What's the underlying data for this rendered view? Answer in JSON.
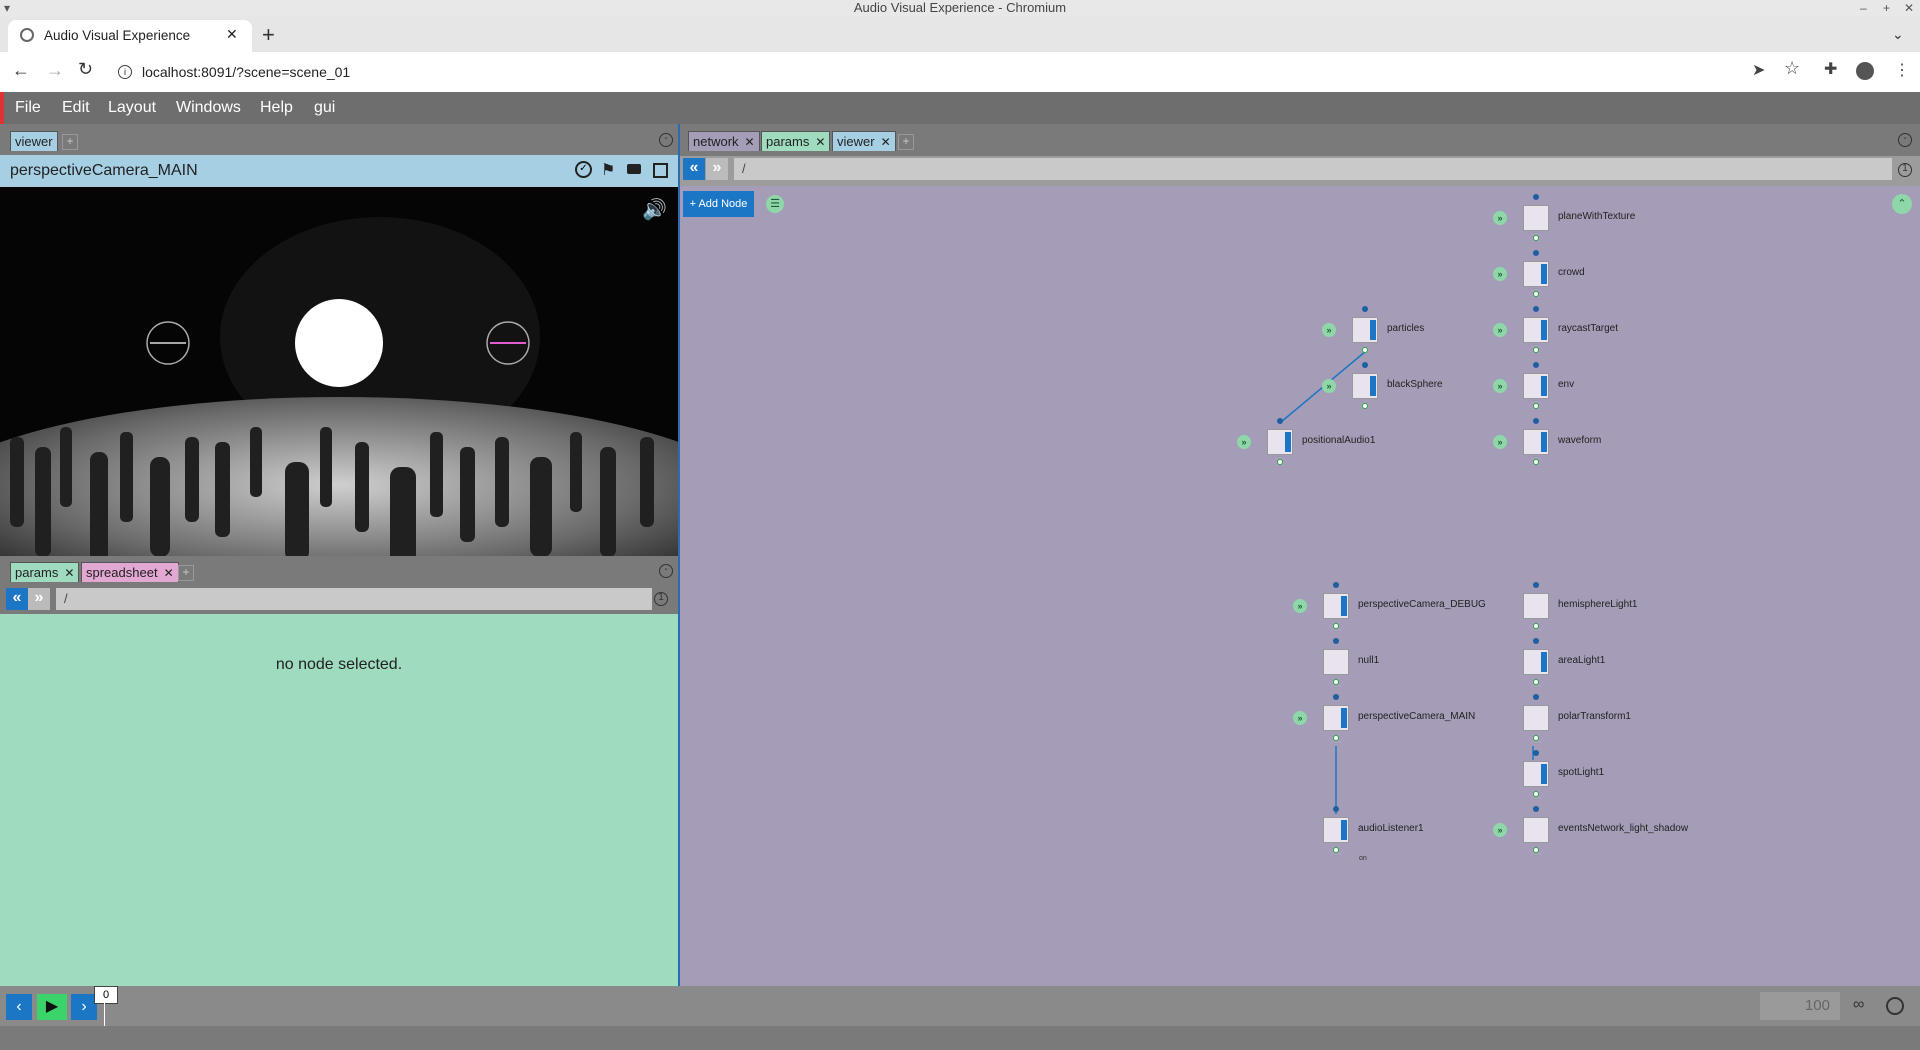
{
  "window": {
    "title": "Audio Visual Experience - Chromium"
  },
  "browser": {
    "tab_title": "Audio Visual Experience",
    "url": "localhost:8091/?scene=scene_01"
  },
  "menu": [
    "File",
    "Edit",
    "Layout",
    "Windows",
    "Help",
    "gui"
  ],
  "viewer_panel": {
    "tab": "viewer",
    "camera_name": "perspectiveCamera_MAIN"
  },
  "params_panel": {
    "tabs": [
      "params",
      "spreadsheet"
    ],
    "path": "/",
    "empty_message": "no node selected."
  },
  "network_panel": {
    "tabs": [
      "network",
      "params",
      "viewer"
    ],
    "path": "/",
    "add_node_label": "+ Add Node",
    "nodes": [
      {
        "name": "planeWithTexture",
        "flag": false,
        "display": true
      },
      {
        "name": "crowd",
        "flag": true,
        "display": true
      },
      {
        "name": "particles",
        "flag": true,
        "display": true
      },
      {
        "name": "raycastTarget",
        "flag": true,
        "display": true
      },
      {
        "name": "blackSphere",
        "flag": true,
        "display": true
      },
      {
        "name": "env",
        "flag": true,
        "display": true
      },
      {
        "name": "positionalAudio1",
        "flag": true,
        "display": true
      },
      {
        "name": "waveform",
        "flag": true,
        "display": true
      },
      {
        "name": "perspectiveCamera_DEBUG",
        "flag": true,
        "display": true
      },
      {
        "name": "hemisphereLight1",
        "flag": false,
        "display": false
      },
      {
        "name": "null1",
        "flag": false,
        "display": false
      },
      {
        "name": "areaLight1",
        "flag": true,
        "display": false
      },
      {
        "name": "perspectiveCamera_MAIN",
        "flag": true,
        "display": true
      },
      {
        "name": "polarTransform1",
        "flag": false,
        "display": false
      },
      {
        "name": "spotLight1",
        "flag": true,
        "display": false
      },
      {
        "name": "audioListener1",
        "flag": true,
        "display": false
      },
      {
        "name": "eventsNetwork_light_shadow",
        "flag": false,
        "display": true
      }
    ],
    "audio_listener_note": "on"
  },
  "timeline": {
    "current_frame": "0",
    "end_frame": "100"
  },
  "colors": {
    "viewer_header": "#a6cfe3",
    "params_bg": "#9edbbf",
    "network_bg": "#a59cb7",
    "accent_blue": "#1b76c5",
    "play_green": "#3ad46a"
  }
}
